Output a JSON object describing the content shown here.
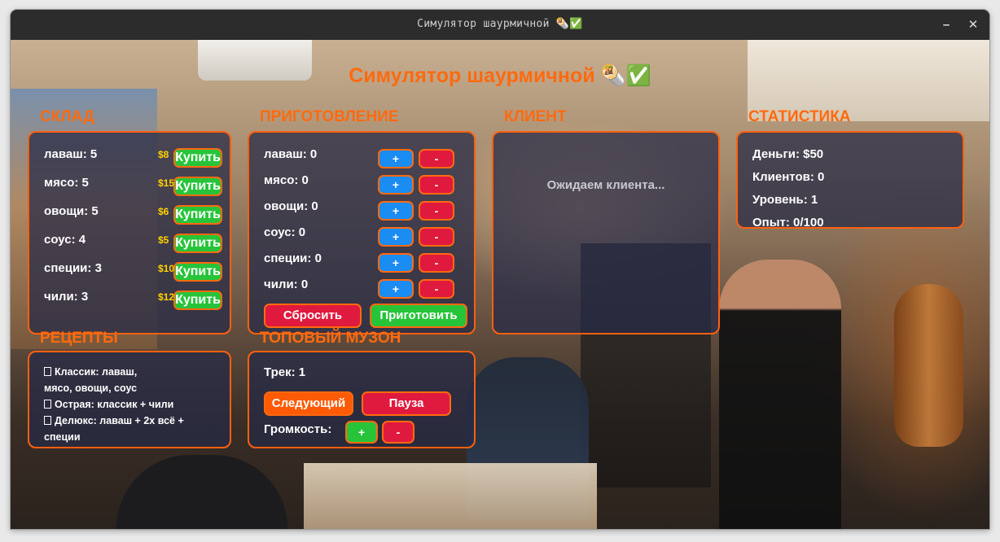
{
  "window": {
    "title": "Симулятор шаурмичной 🌯✅",
    "minimize_glyph": "–",
    "close_glyph": "✕"
  },
  "app": {
    "title": "Симулятор шаурмичной 🌯✅"
  },
  "colors": {
    "accent": "#ff6a0e",
    "panel_border": "#ff6010",
    "buy": "#27c43a",
    "plus": "#1a8cf2",
    "minus": "#e0193e",
    "price": "#ffd200"
  },
  "warehouse": {
    "title": "СКЛАД",
    "buy_label": "Купить",
    "items": [
      {
        "label": "лаваш: 5",
        "price": "$8"
      },
      {
        "label": "мясо: 5",
        "price": "$15"
      },
      {
        "label": "овощи: 5",
        "price": "$6"
      },
      {
        "label": "соус: 4",
        "price": "$5"
      },
      {
        "label": "специи: 3",
        "price": "$10"
      },
      {
        "label": "чили: 3",
        "price": "$12"
      }
    ]
  },
  "cooking": {
    "title": "ПРИГОТОВЛЕНИЕ",
    "plus_label": "+",
    "minus_label": "-",
    "items": [
      {
        "label": "лаваш: 0"
      },
      {
        "label": "мясо: 0"
      },
      {
        "label": "овощи: 0"
      },
      {
        "label": "соус: 0"
      },
      {
        "label": "специи: 0"
      },
      {
        "label": "чили: 0"
      }
    ],
    "reset_label": "Сбросить",
    "cook_label": "Приготовить"
  },
  "client": {
    "title": "КЛИЕНТ",
    "status": "Ожидаем клиента..."
  },
  "stats": {
    "title": "СТАТИСТИКА",
    "lines": [
      "Деньги: $50",
      "Клиентов: 0",
      "Уровень: 1",
      "Опыт: 0/100"
    ]
  },
  "recipes": {
    "title": "РЕЦЕПТЫ",
    "lines": [
      "Классик: лаваш,",
      "мясо, овощи, соус",
      "Острая: классик + чили",
      "Делюкс: лаваш + 2х всё +",
      "специи"
    ]
  },
  "music": {
    "title": "ТОПОВЫЙ МУЗОН",
    "track": "Трек: 1",
    "next_label": "Следующий",
    "pause_label": "Пауза",
    "volume_label": "Громкость:",
    "vol_up": "+",
    "vol_down": "-"
  }
}
